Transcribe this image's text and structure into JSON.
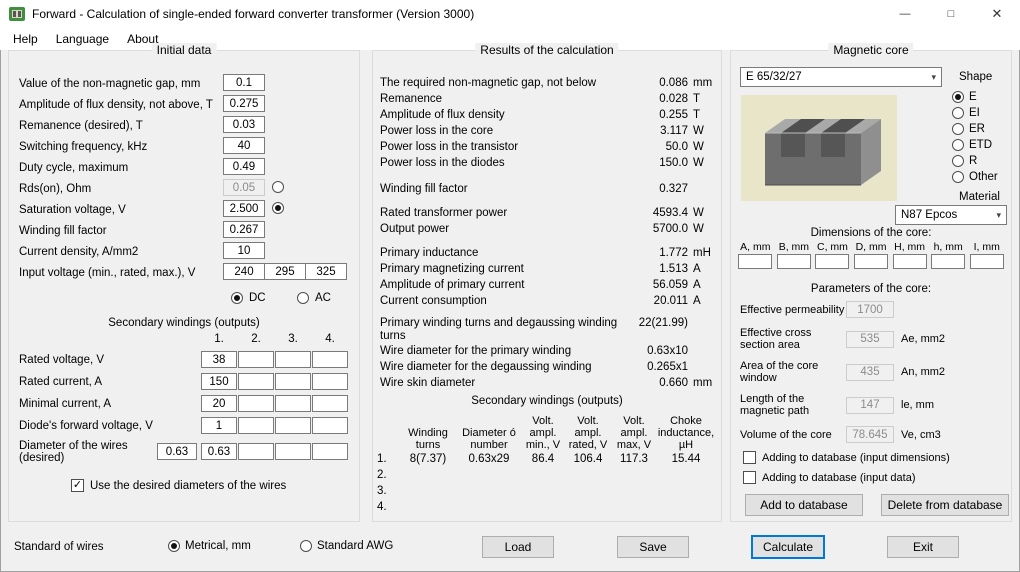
{
  "window": {
    "title": "Forward - Calculation of single-ended forward converter transformer (Version 3000)",
    "minimize": "—",
    "maximize": "□",
    "close": "✕"
  },
  "icons": {
    "chevron_down": "▾",
    "check": "✓"
  },
  "menu": {
    "items": [
      "Help",
      "Language",
      "About"
    ]
  },
  "initial": {
    "title": "Initial data",
    "fields": [
      {
        "label": "Value of the non-magnetic gap, mm",
        "value": "0.1"
      },
      {
        "label": "Amplitude of flux density, not above, T",
        "value": "0.275"
      },
      {
        "label": "Remanence (desired), T",
        "value": "0.03"
      },
      {
        "label": "Switching frequency, kHz",
        "value": "40"
      },
      {
        "label": "Duty cycle, maximum",
        "value": "0.49"
      }
    ],
    "rds": {
      "label": "Rds(on), Ohm",
      "value": "0.05"
    },
    "saturation": {
      "label": "Saturation voltage, V",
      "value": "2.500"
    },
    "fields2": [
      {
        "label": "Winding fill factor",
        "value": "0.267"
      },
      {
        "label": "Current density, A/mm2",
        "value": "10"
      }
    ],
    "input_voltage": {
      "label": "Input voltage (min., rated, max.), V",
      "values": [
        "240",
        "295",
        "325"
      ]
    },
    "dc": "DC",
    "ac": "AC",
    "secondary": {
      "title": "Secondary windings (outputs)",
      "columns": [
        "1.",
        "2.",
        "3.",
        "4."
      ],
      "rows": [
        {
          "label": "Rated voltage, V",
          "values": [
            "38",
            "",
            "",
            ""
          ]
        },
        {
          "label": "Rated current, A",
          "values": [
            "150",
            "",
            "",
            ""
          ]
        },
        {
          "label": "Minimal current, A",
          "values": [
            "20",
            "",
            "",
            ""
          ]
        },
        {
          "label": "Diode's forward voltage, V",
          "values": [
            "1",
            "",
            "",
            ""
          ]
        }
      ],
      "diameter": {
        "label": "Diameter of the wires (desired)",
        "desired": "0.63",
        "values": [
          "0.63",
          "",
          "",
          ""
        ]
      },
      "use_desired": "Use the desired diameters of the wires"
    }
  },
  "results": {
    "title": "Results of the calculation",
    "rows": [
      {
        "label": "The required non-magnetic gap, not below",
        "value": "0.086",
        "unit": "mm"
      },
      {
        "label": "Remanence",
        "value": "0.028",
        "unit": "T"
      },
      {
        "label": "Amplitude of flux density",
        "value": "0.255",
        "unit": "T"
      },
      {
        "label": "Power loss in the core",
        "value": "3.117",
        "unit": "W"
      },
      {
        "label": "Power loss in the transistor",
        "value": "50.0",
        "unit": "W"
      },
      {
        "label": "Power loss in the diodes",
        "value": "150.0",
        "unit": "W"
      },
      {
        "label": "Winding fill factor",
        "value": "0.327",
        "unit": ""
      },
      {
        "label": "Rated transformer power",
        "value": "4593.4",
        "unit": "W"
      },
      {
        "label": "Output power",
        "value": "5700.0",
        "unit": "W"
      },
      {
        "label": "Primary inductance",
        "value": "1.772",
        "unit": "mH"
      },
      {
        "label": "Primary magnetizing current",
        "value": "1.513",
        "unit": "A"
      },
      {
        "label": "Amplitude of primary current",
        "value": "56.059",
        "unit": "A"
      },
      {
        "label": "Current consumption",
        "value": "20.011",
        "unit": "A"
      },
      {
        "label": "Primary winding turns and degaussing winding turns",
        "value": "22(21.99)",
        "unit": ""
      },
      {
        "label": "Wire diameter for the primary winding",
        "value": "0.63x10",
        "unit": ""
      },
      {
        "label": "Wire diameter for the degaussing winding",
        "value": "0.265x1",
        "unit": ""
      },
      {
        "label": "Wire skin diameter",
        "value": "0.660",
        "unit": "mm"
      }
    ],
    "secondary": {
      "title": "Secondary windings (outputs)",
      "headers": [
        "Winding\nturns",
        "Diameter ó\nnumber",
        "Volt.\nampl.\nmin., V",
        "Volt.\nampl.\nrated, V",
        "Volt.\nampl.\nmax, V",
        "Choke\ninductance,\nµH"
      ],
      "row_numbers": [
        "1.",
        "2.",
        "3.",
        "4."
      ],
      "rows": [
        [
          "8(7.37)",
          "0.63x29",
          "86.4",
          "106.4",
          "117.3",
          "15.44"
        ],
        [
          "",
          "",
          "",
          "",
          "",
          ""
        ],
        [
          "",
          "",
          "",
          "",
          "",
          ""
        ],
        [
          "",
          "",
          "",
          "",
          "",
          ""
        ]
      ]
    }
  },
  "core": {
    "title": "Magnetic core",
    "selected": "E 65/32/27",
    "shape_label": "Shape",
    "shapes": [
      "E",
      "EI",
      "ER",
      "ETD",
      "R",
      "Other"
    ],
    "material_label": "Material",
    "material": "N87 Epcos",
    "dimensions_label": "Dimensions of the core:",
    "dimension_labels": [
      "A, mm",
      "B, mm",
      "C, mm",
      "D, mm",
      "H, mm",
      "h, mm",
      "I, mm"
    ],
    "parameters_label": "Parameters of the core:",
    "parameters": [
      {
        "label": "Effective permeability",
        "value": "1700",
        "unit": ""
      },
      {
        "label": "Effective cross section area",
        "value": "535",
        "unit": "Ae, mm2"
      },
      {
        "label": "Area of the core window",
        "value": "435",
        "unit": "An, mm2"
      },
      {
        "label": "Length of the magnetic path",
        "value": "147",
        "unit": "le, mm"
      },
      {
        "label": "Volume of the core",
        "value": "78.645",
        "unit": "Ve, cm3"
      }
    ],
    "add_dims_checkbox": "Adding to database (input dimensions)",
    "add_data_checkbox": "Adding to database (input data)",
    "add_button": "Add to database",
    "delete_button": "Delete from database"
  },
  "footer": {
    "standard_label": "Standard of wires",
    "metric": "Metrical, mm",
    "awg": "Standard AWG",
    "load": "Load",
    "save": "Save",
    "calculate": "Calculate",
    "exit": "Exit"
  }
}
